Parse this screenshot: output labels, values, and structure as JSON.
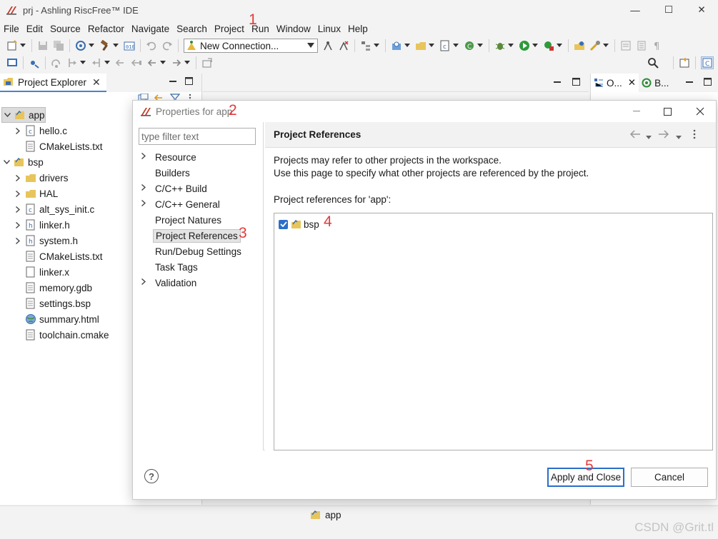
{
  "window": {
    "title": "prj - Ashling RiscFree™ IDE",
    "minimize_glyph": "—",
    "maximize_glyph": "☐",
    "close_glyph": "✕"
  },
  "menu": [
    "File",
    "Edit",
    "Source",
    "Refactor",
    "Navigate",
    "Search",
    "Project",
    "Run",
    "Window",
    "Linux",
    "Help"
  ],
  "toolbar": {
    "connection_value": "New Connection..."
  },
  "project_explorer": {
    "tab_label": "Project Explorer",
    "close_glyph": "✕",
    "tree": [
      {
        "label": "app",
        "icon": "project-folder-icon",
        "level": 0,
        "chevron": "v",
        "selected": true
      },
      {
        "label": "hello.c",
        "icon": "c-file-icon",
        "level": 1,
        "chevron": ">"
      },
      {
        "label": "CMakeLists.txt",
        "icon": "text-file-icon",
        "level": 1,
        "chevron": ""
      },
      {
        "label": "bsp",
        "icon": "project-folder-icon",
        "level": 0,
        "chevron": "v"
      },
      {
        "label": "drivers",
        "icon": "folder-icon",
        "level": 1,
        "chevron": ">"
      },
      {
        "label": "HAL",
        "icon": "folder-icon",
        "level": 1,
        "chevron": ">"
      },
      {
        "label": "alt_sys_init.c",
        "icon": "c-file-icon",
        "level": 1,
        "chevron": ">"
      },
      {
        "label": "linker.h",
        "icon": "h-file-icon",
        "level": 1,
        "chevron": ">"
      },
      {
        "label": "system.h",
        "icon": "h-file-icon",
        "level": 1,
        "chevron": ">"
      },
      {
        "label": "CMakeLists.txt",
        "icon": "text-file-icon",
        "level": 1,
        "chevron": ""
      },
      {
        "label": "linker.x",
        "icon": "blank-file-icon",
        "level": 1,
        "chevron": ""
      },
      {
        "label": "memory.gdb",
        "icon": "text-file-icon",
        "level": 1,
        "chevron": ""
      },
      {
        "label": "settings.bsp",
        "icon": "text-file-icon",
        "level": 1,
        "chevron": ""
      },
      {
        "label": "summary.html",
        "icon": "globe-icon",
        "level": 1,
        "chevron": ""
      },
      {
        "label": "toolchain.cmake",
        "icon": "text-file-icon",
        "level": 1,
        "chevron": ""
      }
    ]
  },
  "outline": {
    "tab1_label": "O...",
    "tab2_label": "B..."
  },
  "dialog": {
    "title": "Properties for app",
    "filter_placeholder": "type filter text",
    "nav_items": [
      {
        "label": "Resource",
        "chevron": ">"
      },
      {
        "label": "Builders",
        "chevron": ""
      },
      {
        "label": "C/C++ Build",
        "chevron": ">"
      },
      {
        "label": "C/C++ General",
        "chevron": ">"
      },
      {
        "label": "Project Natures",
        "chevron": ""
      },
      {
        "label": "Project References",
        "chevron": "",
        "selected": true
      },
      {
        "label": "Run/Debug Settings",
        "chevron": ""
      },
      {
        "label": "Task Tags",
        "chevron": ""
      },
      {
        "label": "Validation",
        "chevron": ">"
      }
    ],
    "page_title": "Project References",
    "desc_line1": "Projects may refer to other projects in the workspace.",
    "desc_line2": "Use this page to specify what other projects are referenced by the project.",
    "refs_label": "Project references for 'app':",
    "references": [
      {
        "label": "bsp",
        "checked": true
      }
    ],
    "help_glyph": "?",
    "apply_close_label": "Apply and Close",
    "cancel_label": "Cancel"
  },
  "status": {
    "project": "app"
  },
  "annotations": [
    "1",
    "2",
    "3",
    "4",
    "5"
  ],
  "watermark": "CSDN @Grit.tl",
  "colors": {
    "accent": "#2c6fc9",
    "annotation": "#e33b3b",
    "selection": "#dcdcdc"
  }
}
